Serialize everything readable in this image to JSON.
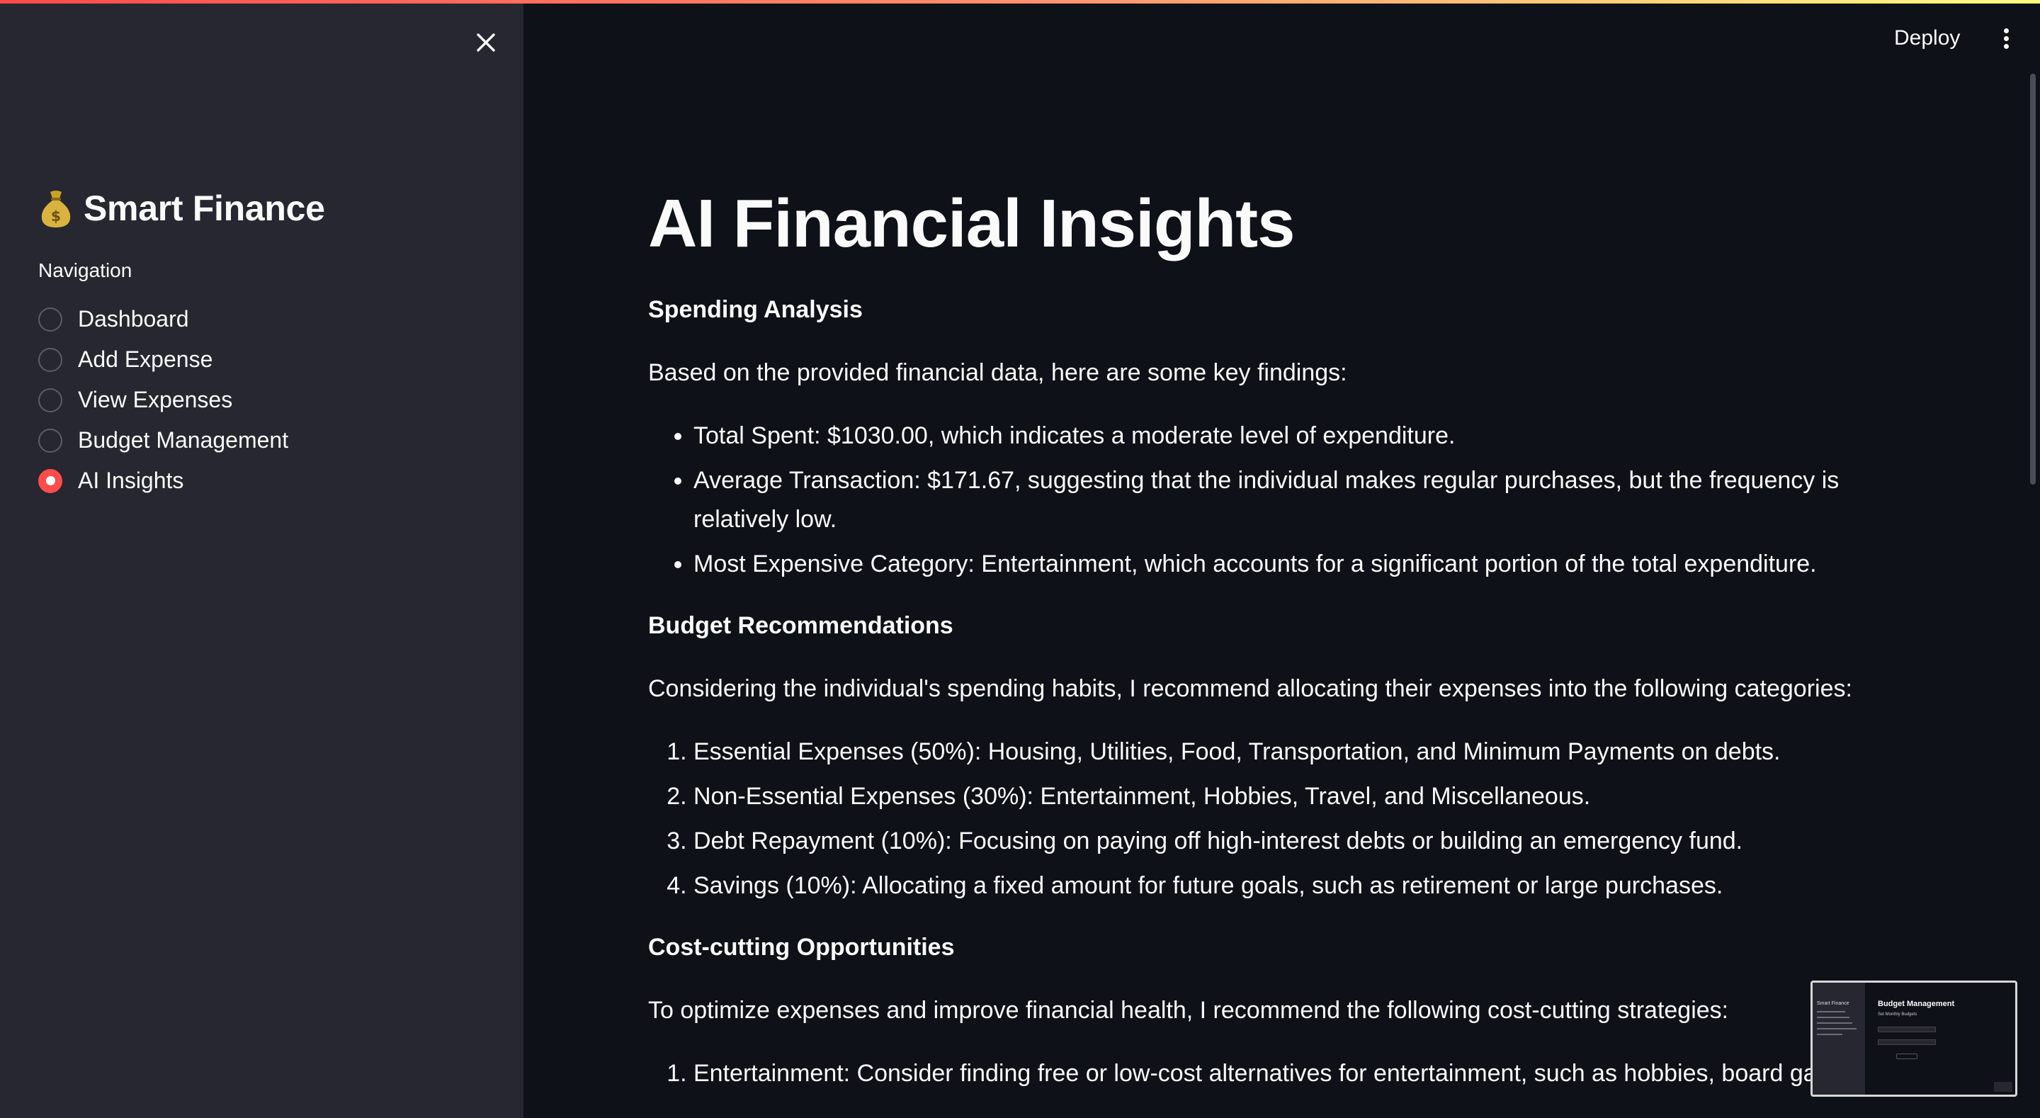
{
  "header": {
    "deploy_label": "Deploy",
    "menu_icon": "kebab-menu-icon",
    "accent_gradient": [
      "#ff4b4b",
      "#ff8f6b",
      "#fffd80"
    ]
  },
  "sidebar": {
    "close_icon": "close-icon",
    "brand_icon": "money-bag-icon",
    "brand_title": "Smart Finance",
    "nav_label": "Navigation",
    "items": [
      {
        "label": "Dashboard",
        "selected": false
      },
      {
        "label": "Add Expense",
        "selected": false
      },
      {
        "label": "View Expenses",
        "selected": false
      },
      {
        "label": "Budget Management",
        "selected": false
      },
      {
        "label": "AI Insights",
        "selected": true
      }
    ],
    "accent_color": "#ff4b4b"
  },
  "main": {
    "title": "AI Financial Insights",
    "spending": {
      "heading": "Spending Analysis",
      "intro": "Based on the provided financial data, here are some key findings:",
      "bullets": [
        "Total Spent: $1030.00, which indicates a moderate level of expenditure.",
        "Average Transaction: $171.67, suggesting that the individual makes regular purchases, but the frequency is relatively low.",
        "Most Expensive Category: Entertainment, which accounts for a significant portion of the total expenditure."
      ]
    },
    "budget": {
      "heading": "Budget Recommendations",
      "intro": "Considering the individual's spending habits, I recommend allocating their expenses into the following categories:",
      "items": [
        "Essential Expenses (50%): Housing, Utilities, Food, Transportation, and Minimum Payments on debts.",
        "Non-Essential Expenses (30%): Entertainment, Hobbies, Travel, and Miscellaneous.",
        "Debt Repayment (10%): Focusing on paying off high-interest debts or building an emergency fund.",
        "Savings (10%): Allocating a fixed amount for future goals, such as retirement or large purchases."
      ]
    },
    "cost_cutting": {
      "heading": "Cost-cutting Opportunities",
      "intro": "To optimize expenses and improve financial health, I recommend the following cost-cutting strategies:",
      "items": [
        "Entertainment: Consider finding free or low-cost alternatives for entertainment, such as hobbies, board gam"
      ]
    }
  },
  "preview": {
    "sidebar_title": "Smart Finance",
    "title": "Budget Management",
    "subtitle": "Set Monthly Budgets"
  }
}
